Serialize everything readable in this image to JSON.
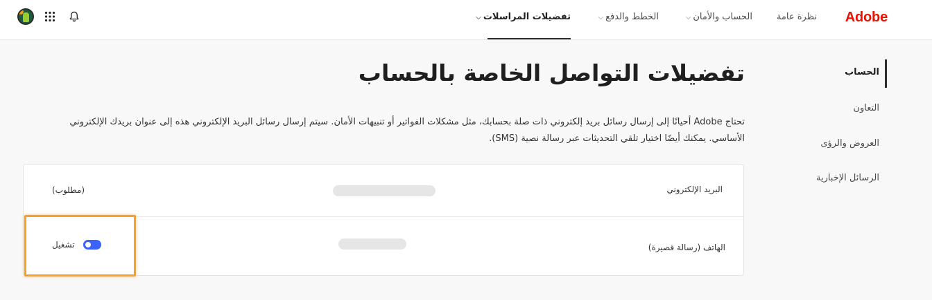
{
  "header": {
    "logo": "Adobe",
    "nav": [
      {
        "label": "نظرة عامة",
        "has_chevron": false
      },
      {
        "label": "الحساب والأمان",
        "has_chevron": true
      },
      {
        "label": "الخطط والدفع",
        "has_chevron": true
      },
      {
        "label": "تفضيلات المراسلات",
        "has_chevron": true,
        "active": true
      }
    ],
    "icons": [
      "bell-icon",
      "apps-grid-icon",
      "avatar"
    ]
  },
  "sidebar": {
    "items": [
      {
        "label": "الحساب",
        "active": true
      },
      {
        "label": "التعاون"
      },
      {
        "label": "العروض والرؤى"
      },
      {
        "label": "الرسائل الإخبارية"
      }
    ]
  },
  "main": {
    "title": "تفضيلات التواصل الخاصة بالحساب",
    "description": "تحتاج Adobe أحيانًا إلى إرسال رسائل بريد إلكتروني ذات صلة بحسابك، مثل مشكلات الفواتير أو تنبيهات الأمان. سيتم إرسال رسائل البريد الإلكتروني هذه إلى عنوان بريدك الإلكتروني الأساسي. يمكنك أيضًا اختيار تلقي التحديثات عبر رسالة نصية (SMS).",
    "rows": [
      {
        "label": "البريد الإلكتروني",
        "status": "(مطلوب)"
      },
      {
        "label": "الهاتف (رسالة قصيرة)",
        "status": "تشغيل",
        "toggle_on": true
      }
    ]
  },
  "colors": {
    "brand": "#eb1000",
    "toggle": "#3b63fb",
    "highlight": "#f5a02a"
  }
}
